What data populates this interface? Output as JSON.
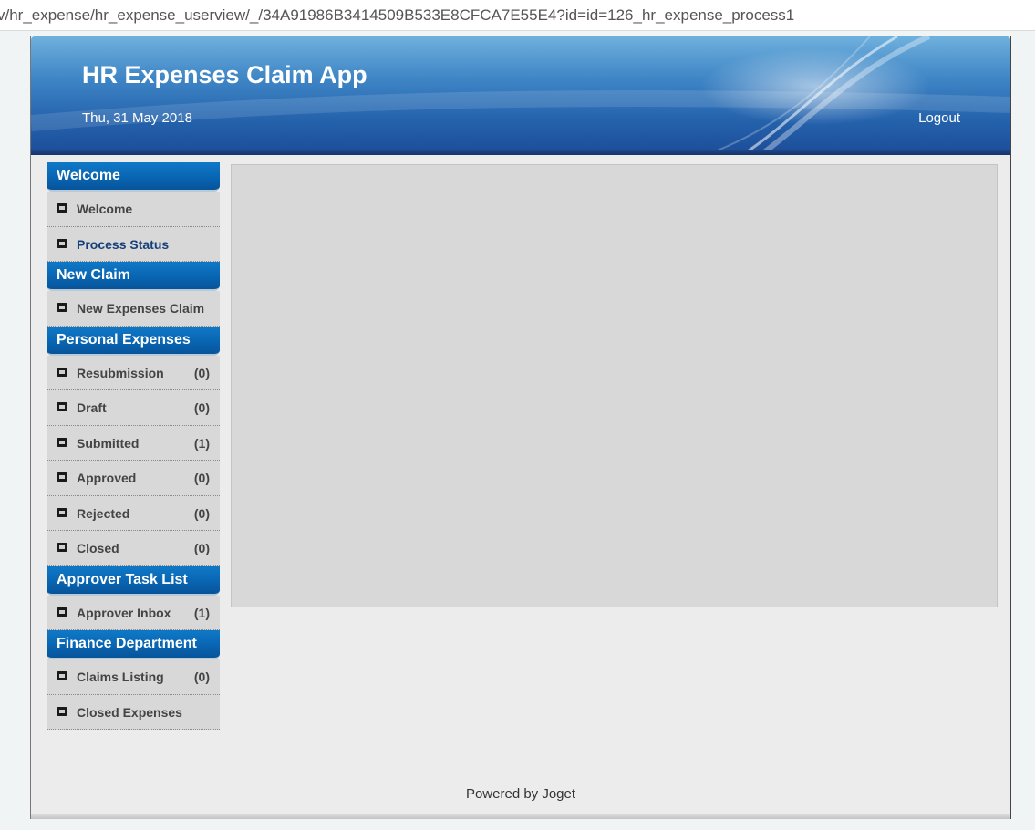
{
  "browser": {
    "url": "v/hr_expense/hr_expense_userview/_/34A91986B3414509B533E8CFCA7E55E4?id=id=126_hr_expense_process1"
  },
  "header": {
    "title": "HR Expenses Claim App",
    "date": "Thu, 31 May 2018",
    "logout_label": "Logout"
  },
  "sidebar": {
    "categories": [
      {
        "label": "Welcome",
        "items": [
          {
            "label": "Welcome",
            "count": ""
          },
          {
            "label": "Process Status",
            "count": ""
          }
        ]
      },
      {
        "label": "New Claim",
        "items": [
          {
            "label": "New Expenses Claim",
            "count": ""
          }
        ]
      },
      {
        "label": "Personal Expenses",
        "items": [
          {
            "label": "Resubmission",
            "count": "(0)"
          },
          {
            "label": "Draft",
            "count": "(0)"
          },
          {
            "label": "Submitted",
            "count": "(1)"
          },
          {
            "label": "Approved",
            "count": "(0)"
          },
          {
            "label": "Rejected",
            "count": "(0)"
          },
          {
            "label": "Closed",
            "count": "(0)"
          }
        ]
      },
      {
        "label": "Approver Task List",
        "items": [
          {
            "label": "Approver Inbox",
            "count": "(1)"
          }
        ]
      },
      {
        "label": "Finance Department",
        "items": [
          {
            "label": "Claims Listing",
            "count": "(0)"
          },
          {
            "label": "Closed Expenses",
            "count": ""
          }
        ]
      }
    ]
  },
  "footer": {
    "text": "Powered by Joget"
  },
  "colors": {
    "header_blue": "#2563ad",
    "category_blue": "#0863b0",
    "menu_bg": "#d8d8d8",
    "active_link": "#173f7a"
  }
}
